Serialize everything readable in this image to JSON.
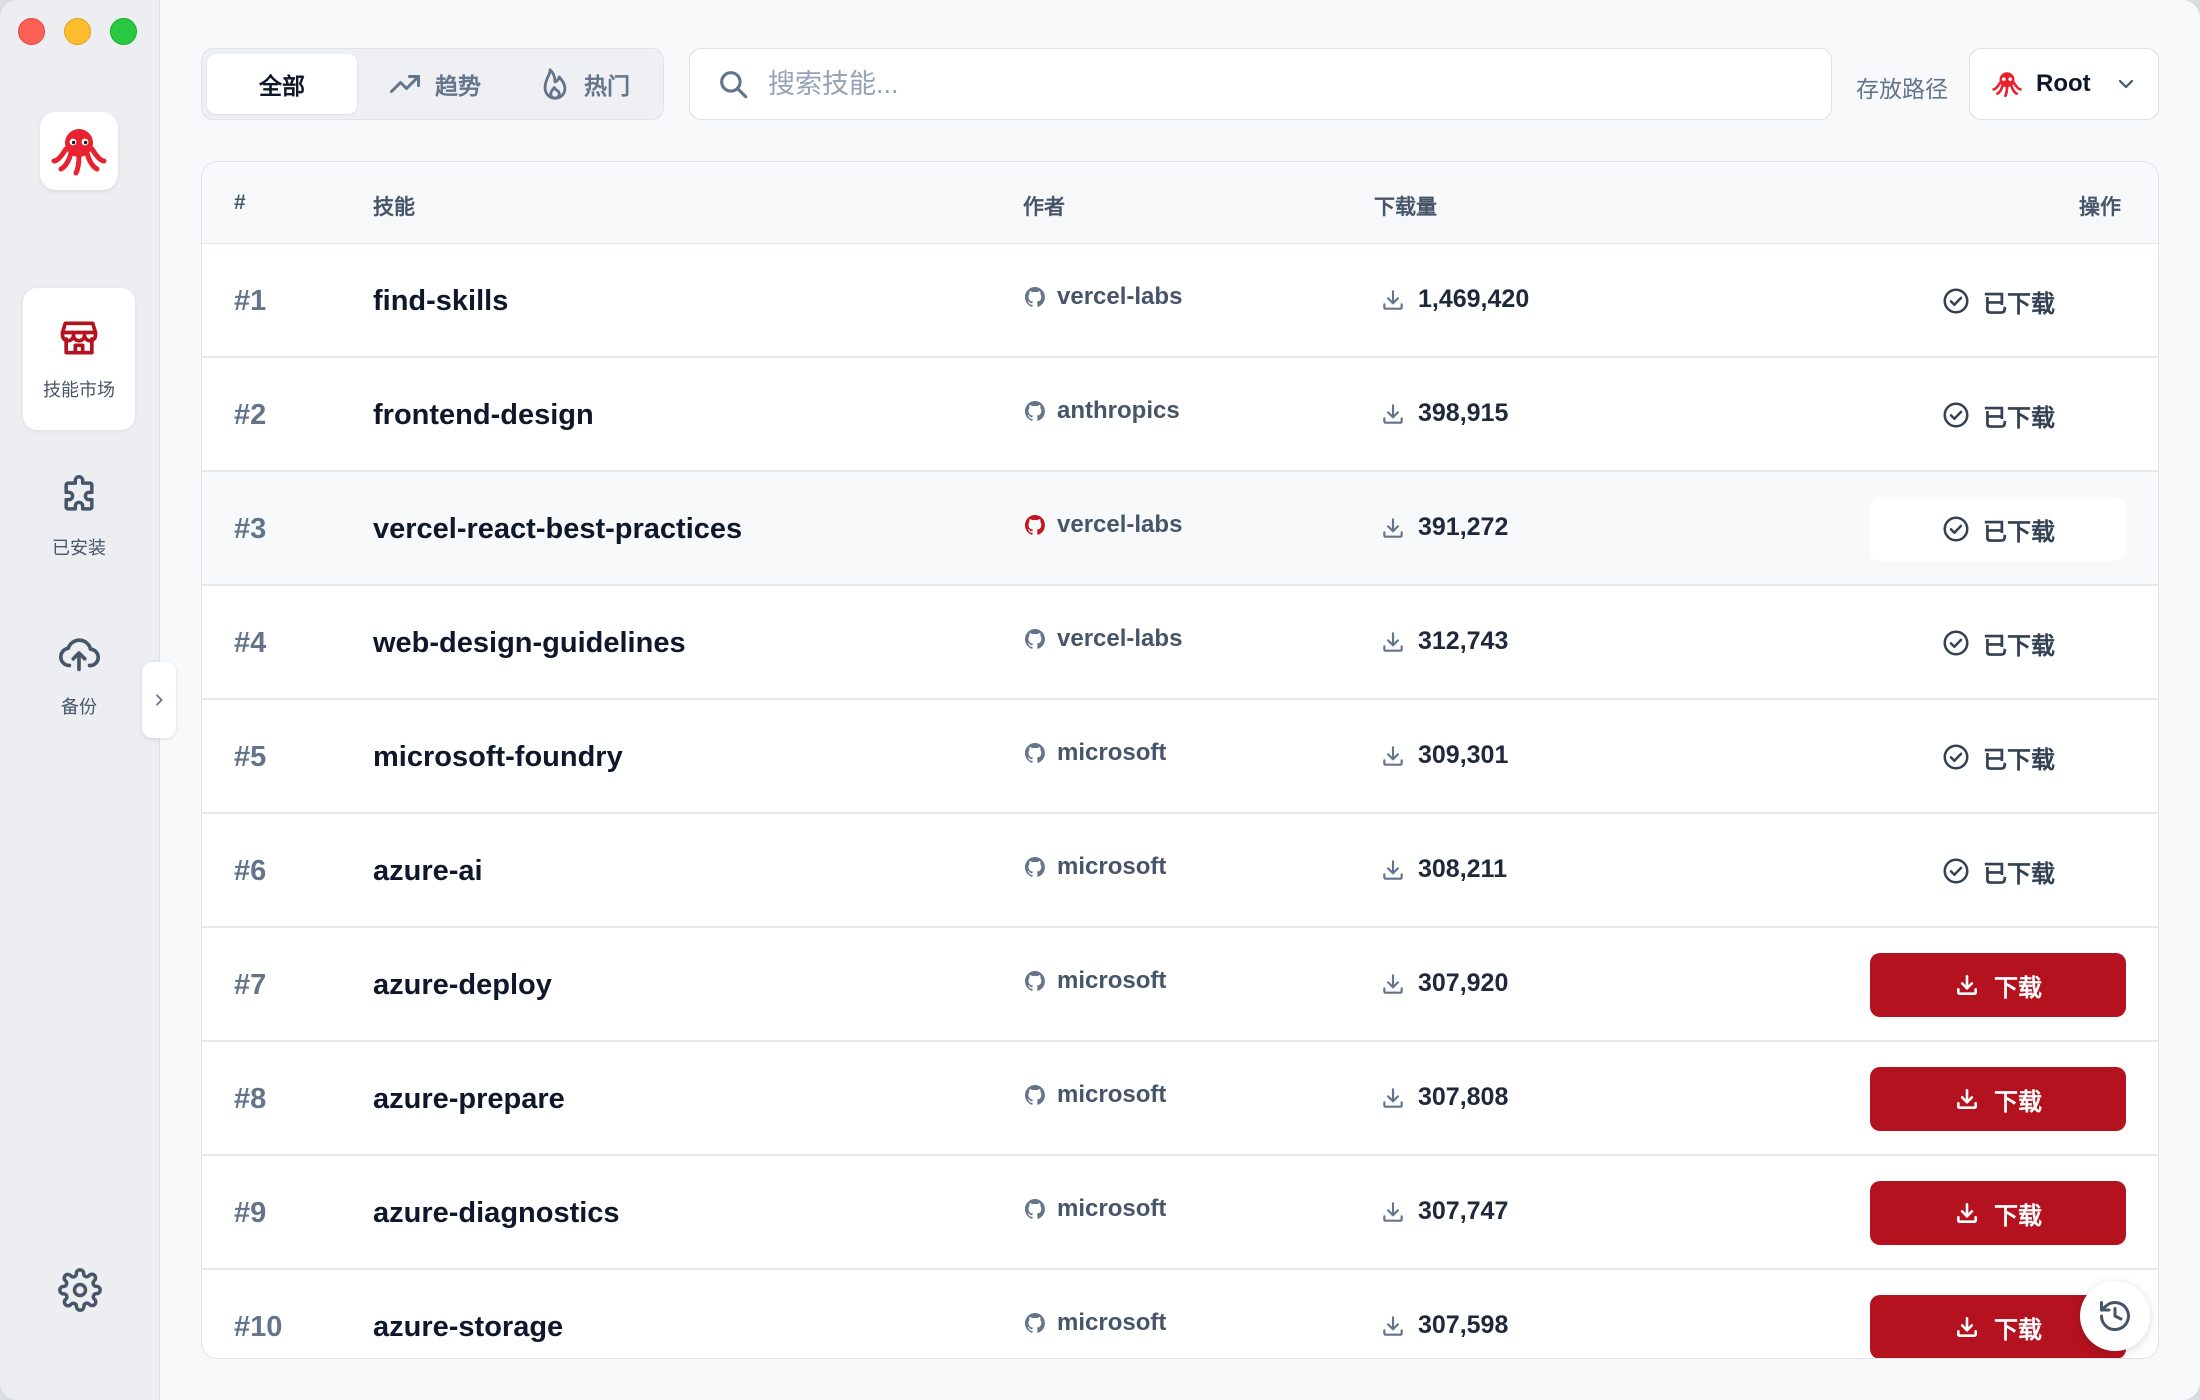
{
  "colors": {
    "accent": "#b5121f",
    "sidebar_bg": "#eceef2",
    "page_bg": "#f8f9fb"
  },
  "sidebar": {
    "logo_icon": "octopus-icon",
    "items": [
      {
        "label": "技能市场",
        "icon": "store-icon",
        "active": true
      },
      {
        "label": "已安装",
        "icon": "puzzle-icon",
        "active": false
      },
      {
        "label": "备份",
        "icon": "cloud-upload-icon",
        "active": false
      }
    ],
    "settings_icon": "gear-icon"
  },
  "tabs": [
    {
      "label": "全部",
      "active": true
    },
    {
      "label": "趋势",
      "icon": "trending-up-icon",
      "active": false
    },
    {
      "label": "热门",
      "icon": "flame-icon",
      "active": false
    }
  ],
  "search": {
    "placeholder": "搜索技能..."
  },
  "storage": {
    "label": "存放路径",
    "value": "Root"
  },
  "table": {
    "headers": {
      "rank": "#",
      "skill": "技能",
      "author": "作者",
      "downloads": "下载量",
      "action": "操作"
    },
    "downloaded_label": "已下载",
    "download_label": "下载",
    "rows": [
      {
        "rank": "#1",
        "skill": "find-skills",
        "author": "vercel-labs",
        "downloads": "1,469,420",
        "status": "downloaded"
      },
      {
        "rank": "#2",
        "skill": "frontend-design",
        "author": "anthropics",
        "downloads": "398,915",
        "status": "downloaded"
      },
      {
        "rank": "#3",
        "skill": "vercel-react-best-practices",
        "author": "vercel-labs",
        "downloads": "391,272",
        "status": "downloaded"
      },
      {
        "rank": "#4",
        "skill": "web-design-guidelines",
        "author": "vercel-labs",
        "downloads": "312,743",
        "status": "downloaded"
      },
      {
        "rank": "#5",
        "skill": "microsoft-foundry",
        "author": "microsoft",
        "downloads": "309,301",
        "status": "downloaded"
      },
      {
        "rank": "#6",
        "skill": "azure-ai",
        "author": "microsoft",
        "downloads": "308,211",
        "status": "downloaded"
      },
      {
        "rank": "#7",
        "skill": "azure-deploy",
        "author": "microsoft",
        "downloads": "307,920",
        "status": "download"
      },
      {
        "rank": "#8",
        "skill": "azure-prepare",
        "author": "microsoft",
        "downloads": "307,808",
        "status": "download"
      },
      {
        "rank": "#9",
        "skill": "azure-diagnostics",
        "author": "microsoft",
        "downloads": "307,747",
        "status": "download"
      },
      {
        "rank": "#10",
        "skill": "azure-storage",
        "author": "microsoft",
        "downloads": "307,598",
        "status": "download"
      }
    ]
  },
  "history_icon": "history-icon"
}
